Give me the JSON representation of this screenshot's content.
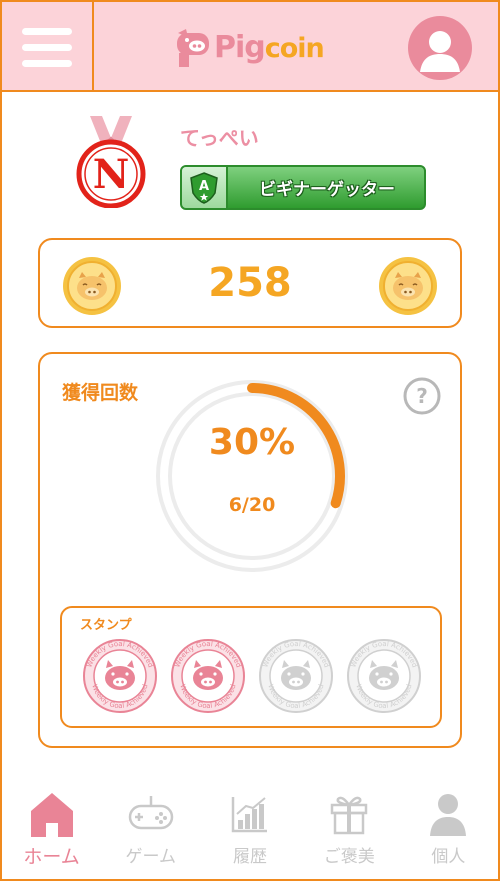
{
  "header": {
    "logo_main": "Pig",
    "logo_sub": "coin"
  },
  "profile": {
    "rank_letter": "N",
    "user_name": "てっぺい",
    "rank_title": "ビギナーゲッター",
    "shield_letter": "A"
  },
  "coins": {
    "value": "258"
  },
  "progress": {
    "title": "獲得回数",
    "percent_text": "30%",
    "fraction_text": "6/20",
    "fraction": 0.3,
    "help_symbol": "?"
  },
  "stamps": {
    "title": "スタンプ",
    "items": [
      {
        "state": "earned",
        "text": "Weekly Goal Achieved"
      },
      {
        "state": "earned",
        "text": "Weekly Goal Achieved"
      },
      {
        "state": "locked",
        "text": "Weekly Goal Achieved"
      },
      {
        "state": "locked",
        "text": "Weekly Goal Achieved"
      }
    ]
  },
  "nav": {
    "items": [
      {
        "label": "ホーム",
        "icon": "home-icon",
        "active": true
      },
      {
        "label": "ゲーム",
        "icon": "gamepad-icon",
        "active": false
      },
      {
        "label": "履歴",
        "icon": "chart-icon",
        "active": false
      },
      {
        "label": "ご褒美",
        "icon": "gift-icon",
        "active": false
      },
      {
        "label": "個人",
        "icon": "person-icon",
        "active": false
      }
    ]
  },
  "colors": {
    "accent": "#f08a1e",
    "pink": "#fcd3d9",
    "pink_dark": "#ea8b9c",
    "coin": "#f5a623",
    "rank_green": "#2f9c2f"
  }
}
